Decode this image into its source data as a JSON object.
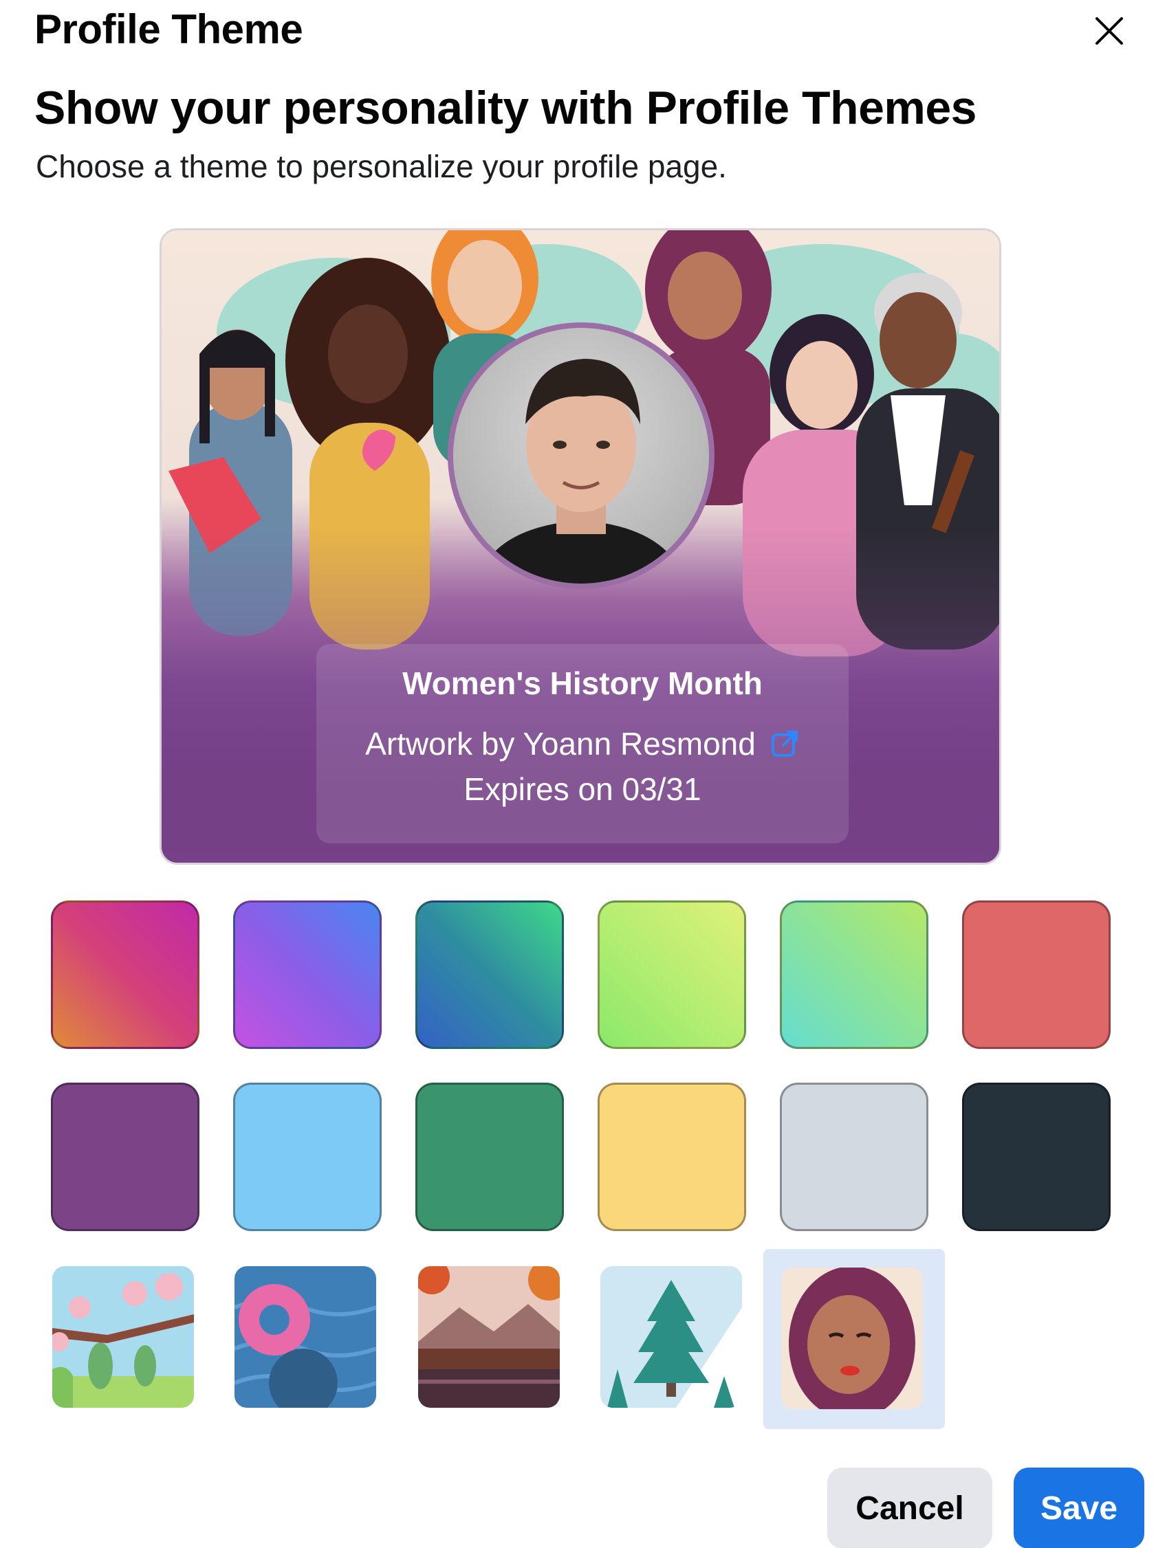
{
  "dialog": {
    "title": "Profile Theme",
    "headline": "Show your personality with Profile Themes",
    "subtitle": "Choose a theme to personalize your profile page."
  },
  "preview": {
    "theme_name": "Women's History Month",
    "artwork_credit": "Artwork by Yoann Resmond",
    "expires": "Expires on 03/31"
  },
  "color_swatches": [
    {
      "name": "sunset-gradient",
      "colors": [
        "#e08a3a",
        "#d4407a",
        "#c02aa8"
      ]
    },
    {
      "name": "purple-blue-gradient",
      "colors": [
        "#c452e2",
        "#8a5ee8",
        "#4a86f0"
      ]
    },
    {
      "name": "blue-green-gradient",
      "colors": [
        "#3462c6",
        "#2f8da0",
        "#3fd98a"
      ]
    },
    {
      "name": "lime-gradient",
      "colors": [
        "#8ce86a",
        "#b6ee72",
        "#e0f07a"
      ]
    },
    {
      "name": "mint-gradient",
      "colors": [
        "#66dccf",
        "#8ae39a",
        "#b6e86a"
      ]
    },
    {
      "name": "coral-solid",
      "colors": [
        "#e06767",
        "#e06767"
      ]
    },
    {
      "name": "plum-solid",
      "colors": [
        "#7b4487",
        "#7b4487"
      ]
    },
    {
      "name": "sky-solid",
      "colors": [
        "#7ccaf5",
        "#7ccaf5"
      ]
    },
    {
      "name": "green-solid",
      "colors": [
        "#3a946c",
        "#3a946c"
      ]
    },
    {
      "name": "yellow-solid",
      "colors": [
        "#fbd77c",
        "#fbd77c"
      ]
    },
    {
      "name": "silver-solid",
      "colors": [
        "#d3d9e1",
        "#d3d9e1"
      ]
    },
    {
      "name": "charcoal-solid",
      "colors": [
        "#25323b",
        "#25323b"
      ]
    }
  ],
  "image_themes": [
    {
      "name": "cherry-blossom-theme"
    },
    {
      "name": "pool-float-theme"
    },
    {
      "name": "autumn-lake-theme"
    },
    {
      "name": "winter-tree-theme"
    },
    {
      "name": "womens-history-theme",
      "selected": true
    }
  ],
  "actions": {
    "cancel_label": "Cancel",
    "save_label": "Save"
  },
  "colors": {
    "accent": "#1b74e4",
    "selected_bg": "#dce8f8"
  }
}
